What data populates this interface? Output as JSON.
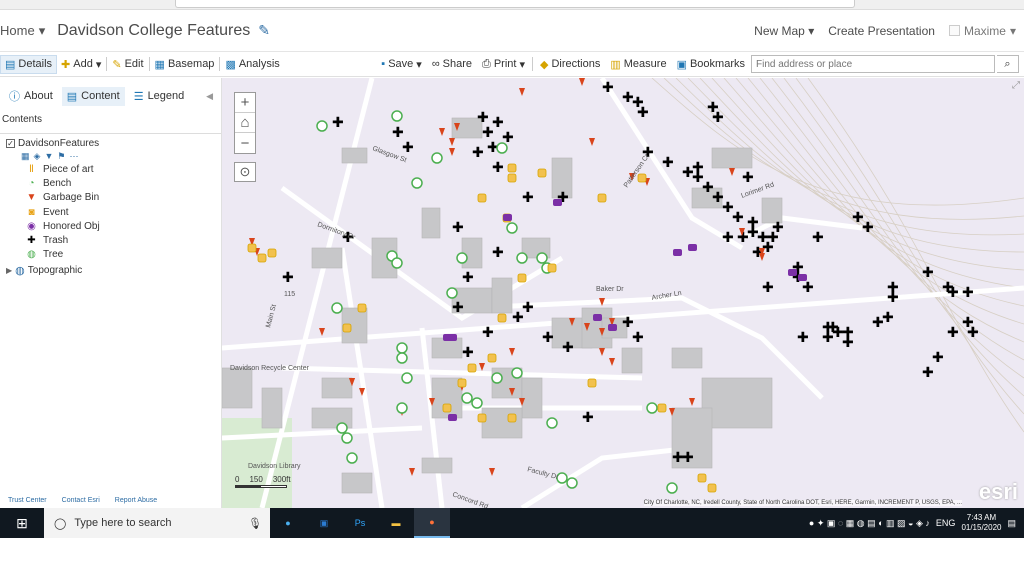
{
  "header": {
    "home_label": "Home",
    "title": "Davidson College Features",
    "new_map": "New Map",
    "create_presentation": "Create Presentation",
    "user": "Maxime"
  },
  "toolbar": {
    "details": "Details",
    "add": "Add",
    "edit": "Edit",
    "basemap": "Basemap",
    "analysis": "Analysis",
    "save": "Save",
    "share": "Share",
    "print": "Print",
    "directions": "Directions",
    "measure": "Measure",
    "bookmarks": "Bookmarks",
    "search_placeholder": "Find address or place"
  },
  "sidebar": {
    "tabs": [
      "About",
      "Content",
      "Legend"
    ],
    "contents_label": "Contents",
    "layer_name": "DavidsonFeatures",
    "legend": [
      {
        "label": "Piece of art",
        "icon": "art-icon",
        "color": "#e8a317"
      },
      {
        "label": "Bench",
        "icon": "bench-icon",
        "color": "#4caf50"
      },
      {
        "label": "Garbage Bin",
        "icon": "garbage-bin-icon",
        "color": "#d9441b"
      },
      {
        "label": "Event",
        "icon": "event-icon",
        "color": "#e8a317"
      },
      {
        "label": "Honored Obj",
        "icon": "honored-icon",
        "color": "#7b2fa6"
      },
      {
        "label": "Trash",
        "icon": "trash-icon",
        "color": "#000000"
      },
      {
        "label": "Tree",
        "icon": "tree-icon",
        "color": "#4caf50"
      }
    ],
    "basemap_layer": "Topographic",
    "footer": [
      "Trust Center",
      "Contact Esri",
      "Report Abuse"
    ]
  },
  "map": {
    "labels": [
      "Glasgow St",
      "Dormitory Dr",
      "Baker Dr",
      "Archer Ln",
      "Patterson Ct",
      "Lorimer Rd",
      "Main St",
      "Faculty Dr",
      "Concord Rd",
      "Davidson Recycle Center",
      "Davidson Library",
      "115"
    ],
    "scale_labels": [
      "0",
      "150",
      "300ft"
    ],
    "attribution": "City Of Charlotte, NC, Iredell County, State of North Carolina DOT, Esri, HERE, Garmin, INCREMENT P, USGS, EPA, ...",
    "logo": "esri"
  },
  "taskbar": {
    "search_placeholder": "Type here to search",
    "time": "7:43 AM",
    "date": "01/15/2020",
    "lang": "ENG"
  }
}
